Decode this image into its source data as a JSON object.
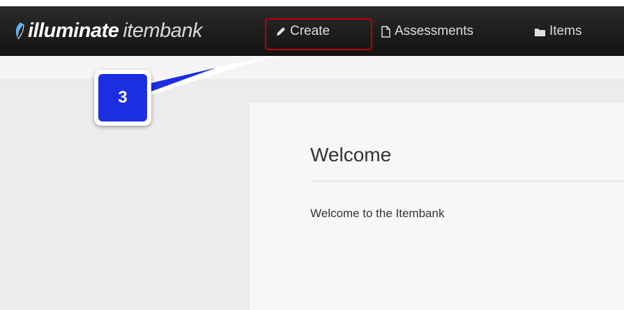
{
  "navbar": {
    "brand_bold": "illuminate",
    "brand_light": "itembank",
    "items": [
      {
        "label": "Create",
        "icon": "pencil-icon"
      },
      {
        "label": "Assessments",
        "icon": "document-icon"
      },
      {
        "label": "Items",
        "icon": "folder-icon"
      }
    ]
  },
  "main": {
    "title": "Welcome",
    "text": "Welcome to the Itembank"
  },
  "annotation": {
    "step_number": "3",
    "highlight_color": "#c00000",
    "badge_color": "#1b2fe0"
  }
}
